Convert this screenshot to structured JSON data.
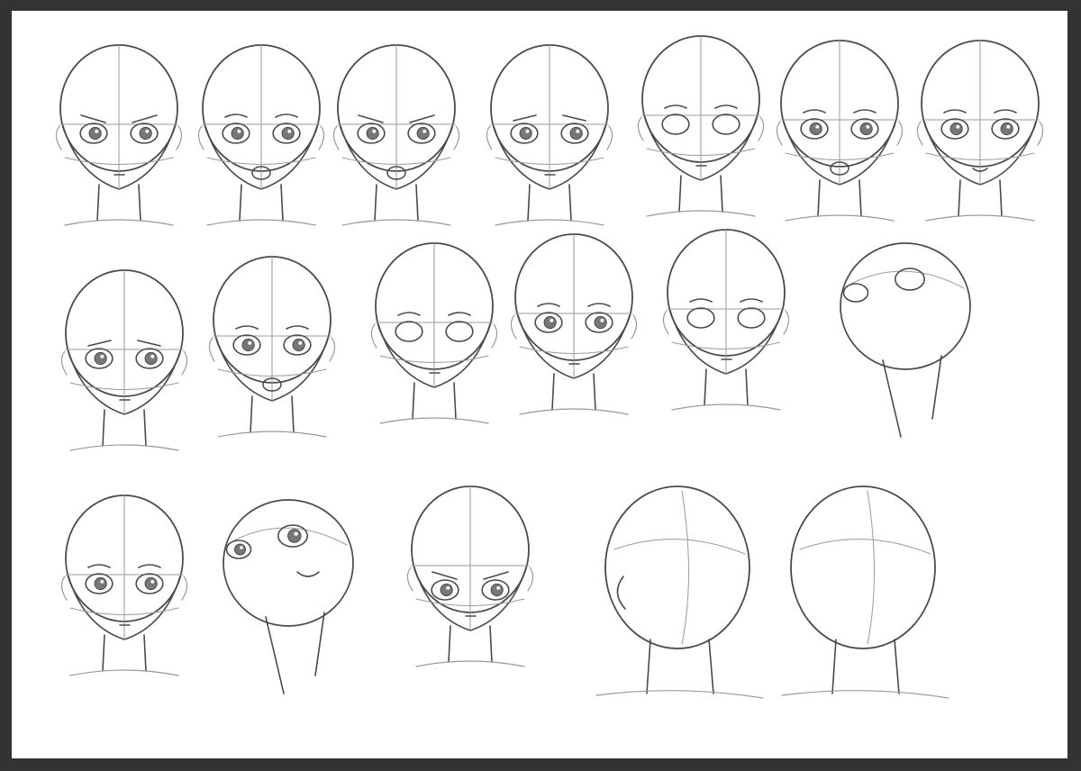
{
  "artwork": {
    "subject": "anime-head-study-sheet",
    "colors": {
      "frame": "#333333",
      "paper": "#ffffff",
      "ink": "#4a4a4a",
      "construction": "#9a9a9a",
      "iris": "#777777"
    },
    "rows": [
      {
        "name": "front-views",
        "heads": [
          {
            "name": "head-front-frown",
            "pose": "front",
            "expression": "frown"
          },
          {
            "name": "head-front-surprised",
            "pose": "front",
            "expression": "surprised"
          },
          {
            "name": "head-front-angry-shout",
            "pose": "front",
            "expression": "angry"
          },
          {
            "name": "head-front-worried",
            "pose": "front",
            "expression": "worried"
          },
          {
            "name": "head-front-neutral",
            "pose": "front",
            "expression": "neutral"
          },
          {
            "name": "head-front-wink-laugh",
            "pose": "front",
            "expression": "wink"
          },
          {
            "name": "head-front-smile",
            "pose": "front",
            "expression": "smile"
          }
        ]
      },
      {
        "name": "tilted-views",
        "heads": [
          {
            "name": "head-front-sad",
            "pose": "front",
            "expression": "sad"
          },
          {
            "name": "head-three-quarter-grin",
            "pose": "three-quarter",
            "expression": "grin"
          },
          {
            "name": "head-tilt-blank",
            "pose": "tilt",
            "expression": "blank"
          },
          {
            "name": "head-three-quarter-shoulder",
            "pose": "three-quarter",
            "expression": "calm"
          },
          {
            "name": "head-side-down",
            "pose": "side-down",
            "expression": "neutral"
          },
          {
            "name": "head-looking-up",
            "pose": "up",
            "expression": "neutral"
          }
        ]
      },
      {
        "name": "extreme-angles",
        "heads": [
          {
            "name": "head-front-sleepy",
            "pose": "front",
            "expression": "sleepy"
          },
          {
            "name": "head-tilt-up-shout",
            "pose": "up-tilt",
            "expression": "shout"
          },
          {
            "name": "head-down-glare",
            "pose": "down",
            "expression": "glare"
          },
          {
            "name": "head-back-three-quarter",
            "pose": "back",
            "expression": "none"
          },
          {
            "name": "head-back-view",
            "pose": "back",
            "expression": "none"
          }
        ]
      }
    ]
  }
}
